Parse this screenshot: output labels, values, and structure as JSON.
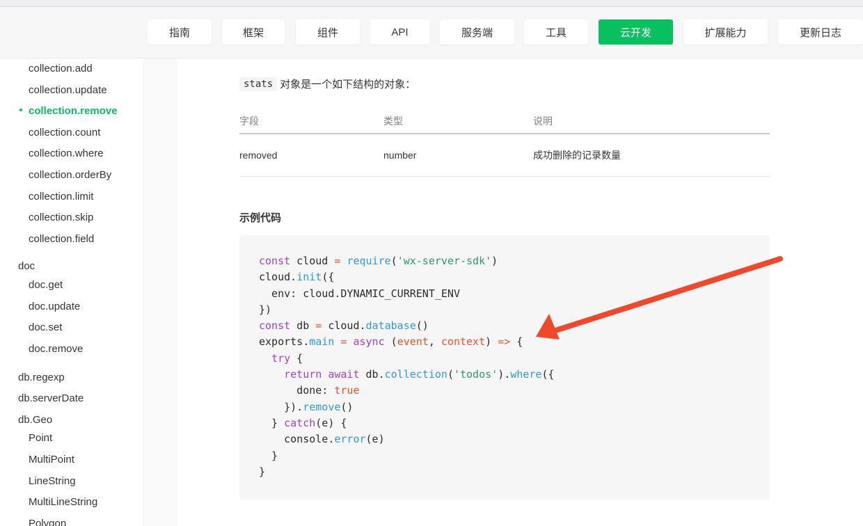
{
  "nav": {
    "items": [
      "指南",
      "框架",
      "组件",
      "API",
      "服务端",
      "工具",
      "云开发",
      "扩展能力",
      "更新日志"
    ],
    "active_index": 6
  },
  "sidebar": {
    "items": [
      {
        "label": "collection.add",
        "level": 2
      },
      {
        "label": "collection.update",
        "level": 2
      },
      {
        "label": "collection.remove",
        "level": 2,
        "active": true
      },
      {
        "label": "collection.count",
        "level": 2
      },
      {
        "label": "collection.where",
        "level": 2
      },
      {
        "label": "collection.orderBy",
        "level": 2
      },
      {
        "label": "collection.limit",
        "level": 2
      },
      {
        "label": "collection.skip",
        "level": 2
      },
      {
        "label": "collection.field",
        "level": 2
      },
      {
        "label": "doc",
        "level": 1
      },
      {
        "label": "doc.get",
        "level": 2
      },
      {
        "label": "doc.update",
        "level": 2
      },
      {
        "label": "doc.set",
        "level": 2
      },
      {
        "label": "doc.remove",
        "level": 2
      },
      {
        "label": "db.regexp",
        "level": 1
      },
      {
        "label": "db.serverDate",
        "level": 1
      },
      {
        "label": "db.Geo",
        "level": 1
      },
      {
        "label": "Point",
        "level": 2
      },
      {
        "label": "MultiPoint",
        "level": 2
      },
      {
        "label": "LineString",
        "level": 2
      },
      {
        "label": "MultiLineString",
        "level": 2
      },
      {
        "label": "Polygon",
        "level": 2
      }
    ]
  },
  "main": {
    "intro_code": "stats",
    "intro_text": "对象是一个如下结构的对象：",
    "table": {
      "headers": [
        "字段",
        "类型",
        "说明"
      ],
      "rows": [
        [
          "removed",
          "number",
          "成功删除的记录数量"
        ]
      ]
    },
    "example_title": "示例代码",
    "code_lines": [
      "const cloud = require('wx-server-sdk')",
      "cloud.init({",
      "  env: cloud.DYNAMIC_CURRENT_ENV",
      "})",
      "const db = cloud.database()",
      "exports.main = async (event, context) => {",
      "  try {",
      "    return await db.collection('todos').where({",
      "      done: true",
      "    }).remove()",
      "  } catch(e) {",
      "    console.error(e)",
      "  }",
      "}"
    ]
  },
  "colors": {
    "accent": "#07c160",
    "annotation_arrow": "#f0482b",
    "keyword": "#a142c9",
    "function": "#2e9adb",
    "string": "#2a9a6a"
  }
}
